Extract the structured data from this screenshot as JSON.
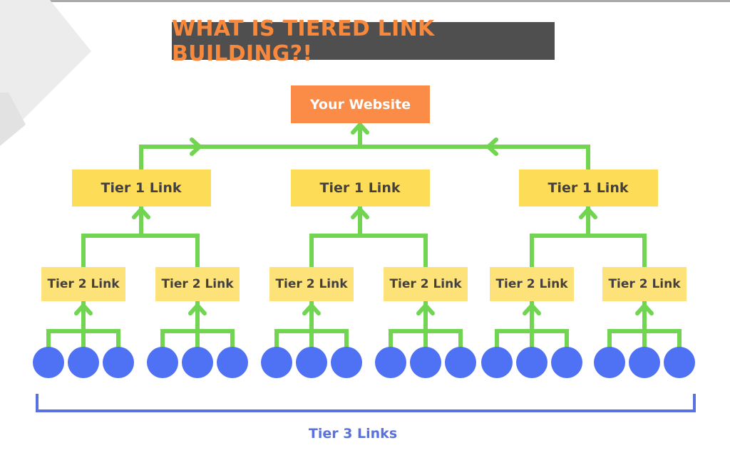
{
  "title": "WHAT IS TIERED LINK BUILDING?!",
  "colors": {
    "title_bg": "#4f4f4f",
    "title_text": "#f7883c",
    "website": "#fb8c48",
    "tier1": "#fddd58",
    "tier2": "#fde27a",
    "connector": "#72d552",
    "tier3_node": "#4f72f4",
    "tier3_bracket": "#5a72e0"
  },
  "website": {
    "label": "Your Website"
  },
  "tier1": [
    {
      "label": "Tier 1 Link",
      "children": [
        {
          "label": "Tier 2 Link",
          "tier3_count": 3
        },
        {
          "label": "Tier 2 Link",
          "tier3_count": 3
        }
      ]
    },
    {
      "label": "Tier 1 Link",
      "children": [
        {
          "label": "Tier 2 Link",
          "tier3_count": 3
        },
        {
          "label": "Tier 2 Link",
          "tier3_count": 3
        }
      ]
    },
    {
      "label": "Tier 1 Link",
      "children": [
        {
          "label": "Tier 2 Link",
          "tier3_count": 3
        },
        {
          "label": "Tier 2 Link",
          "tier3_count": 3
        }
      ]
    }
  ],
  "tier3": {
    "label": "Tier 3 Links"
  }
}
